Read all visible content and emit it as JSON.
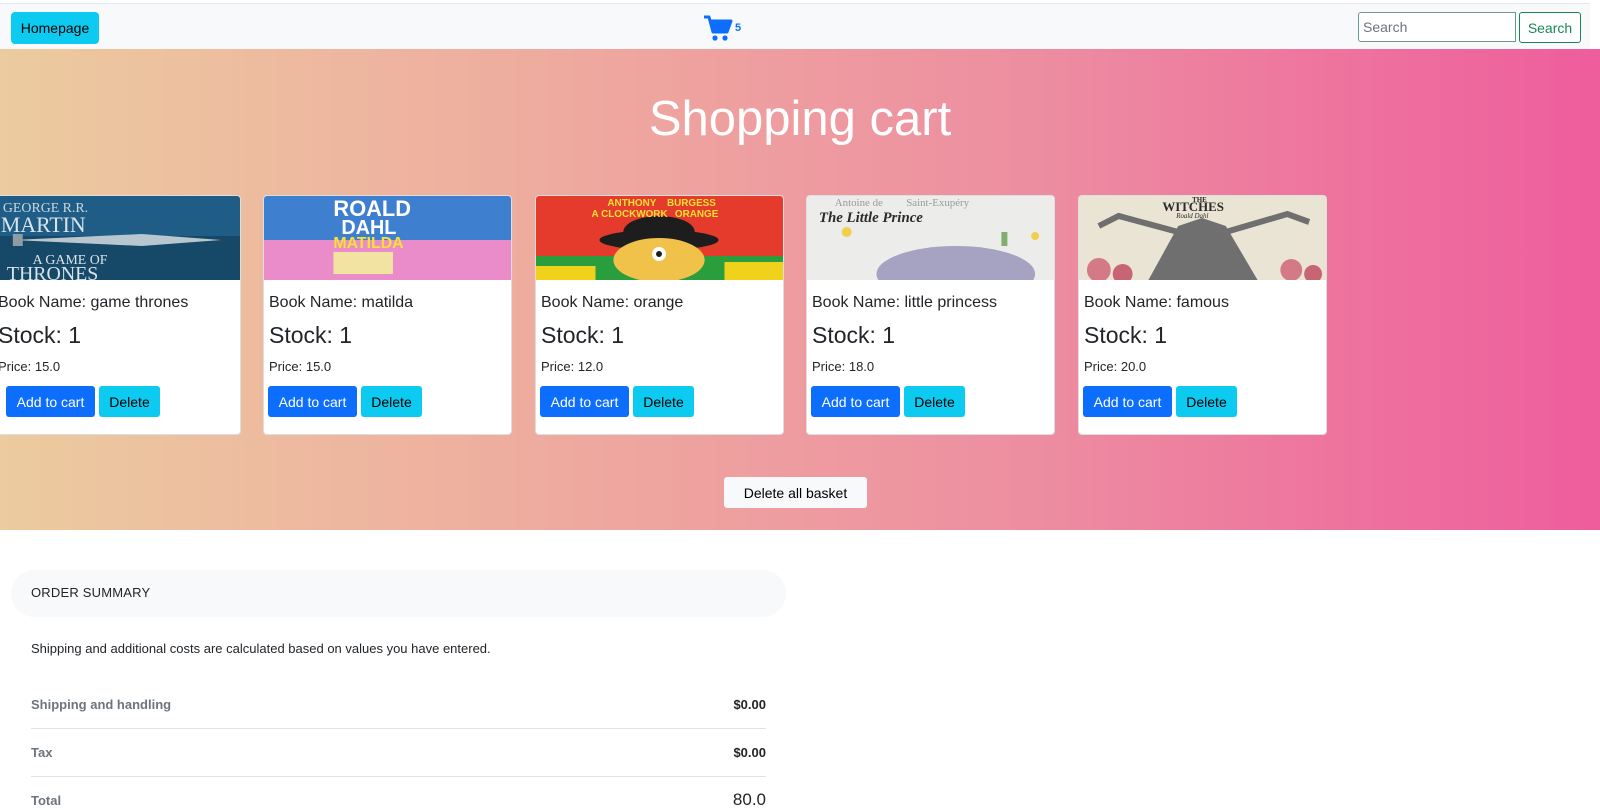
{
  "navbar": {
    "home_label": "Homepage",
    "cart_count": "5",
    "search_placeholder": "Search",
    "search_button": "Search"
  },
  "hero": {
    "title": "Shopping cart",
    "delete_all_label": "Delete all basket"
  },
  "books": [
    {
      "name": "Book Name: game thrones",
      "stock": "Stock: 1",
      "price": "Price: 15.0",
      "add_label": "Add to cart",
      "delete_label": "Delete",
      "cover_text": [
        "GEORGE R.R.",
        "MARTIN",
        "A GAME OF",
        "THRONES"
      ]
    },
    {
      "name": "Book Name: matilda",
      "stock": "Stock: 1",
      "price": "Price: 15.0",
      "add_label": "Add to cart",
      "delete_label": "Delete",
      "cover_text": [
        "ROALD",
        "DAHL",
        "MATILDA"
      ]
    },
    {
      "name": "Book Name: orange",
      "stock": "Stock: 1",
      "price": "Price: 12.0",
      "add_label": "Add to cart",
      "delete_label": "Delete",
      "cover_text": [
        "ANTHONY",
        "BURGESS",
        "A CLOCKWORK",
        "ORANGE"
      ]
    },
    {
      "name": "Book Name: little princess",
      "stock": "Stock: 1",
      "price": "Price: 18.0",
      "add_label": "Add to cart",
      "delete_label": "Delete",
      "cover_text": [
        "Antoine de",
        "Saint-Exupéry",
        "The Little Prince"
      ]
    },
    {
      "name": "Book Name: famous",
      "stock": "Stock: 1",
      "price": "Price: 20.0",
      "add_label": "Add to cart",
      "delete_label": "Delete",
      "cover_text": [
        "THE",
        "WITCHES",
        "Roald Dahl"
      ]
    }
  ],
  "summary": {
    "header": "ORDER SUMMARY",
    "note": "Shipping and additional costs are calculated based on values you have entered.",
    "rows": [
      {
        "label": "Shipping and handling",
        "value": "$0.00"
      },
      {
        "label": "Tax",
        "value": "$0.00"
      },
      {
        "label": "Total",
        "value": "80.0"
      }
    ]
  },
  "colors": {
    "primary": "#0d6efd",
    "info": "#0dcaf0",
    "success": "#198754",
    "gradient_start": "#eccb9f",
    "gradient_end": "#ee5d9d"
  }
}
